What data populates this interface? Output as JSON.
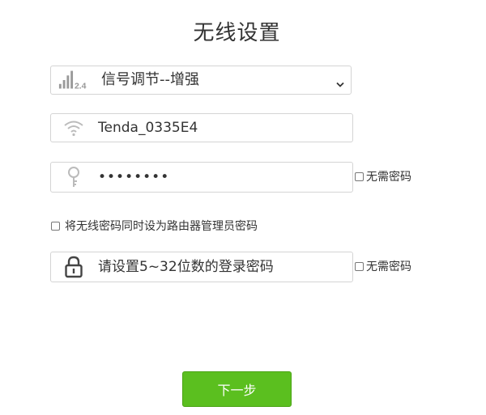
{
  "page": {
    "title": "无线设置"
  },
  "signal": {
    "selected": "信号调节--增强",
    "band_label": "2.4",
    "icon": "signal-2.4g-icon"
  },
  "ssid": {
    "value": "Tenda_0335E4",
    "icon": "wifi-icon"
  },
  "wifi_password": {
    "value": "••••••••",
    "icon": "key-icon",
    "no_password_label": "无需密码"
  },
  "sync_password": {
    "label": "将无线密码同时设为路由器管理员密码"
  },
  "admin_password": {
    "placeholder": "请设置5~32位数的登录密码",
    "icon": "lock-icon",
    "no_password_label": "无需密码"
  },
  "actions": {
    "next_label": "下一步"
  },
  "colors": {
    "primary": "#5bbf1f",
    "border": "#d4d4d4",
    "icon": "#999999"
  }
}
